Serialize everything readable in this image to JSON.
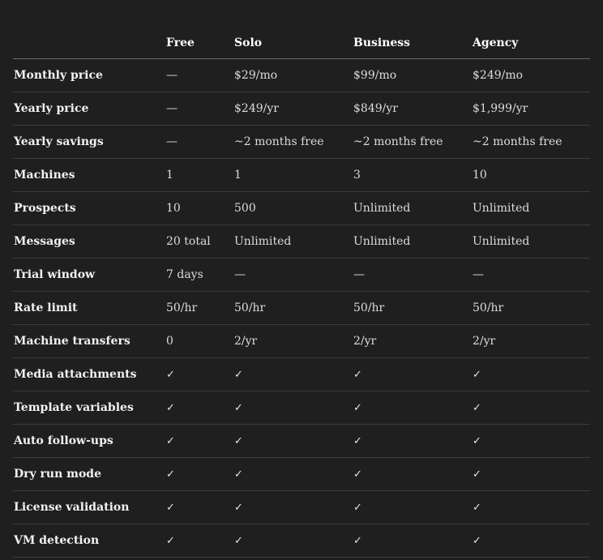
{
  "plans": [
    "Free",
    "Solo",
    "Business",
    "Agency"
  ],
  "rows": [
    {
      "label": "Monthly price",
      "values": [
        "—",
        "$29/mo",
        "$99/mo",
        "$249/mo"
      ]
    },
    {
      "label": "Yearly price",
      "values": [
        "—",
        "$249/yr",
        "$849/yr",
        "$1,999/yr"
      ]
    },
    {
      "label": "Yearly savings",
      "values": [
        "—",
        "~2 months free",
        "~2 months free",
        "~2 months free"
      ]
    },
    {
      "label": "Machines",
      "values": [
        "1",
        "1",
        "3",
        "10"
      ]
    },
    {
      "label": "Prospects",
      "values": [
        "10",
        "500",
        "Unlimited",
        "Unlimited"
      ]
    },
    {
      "label": "Messages",
      "values": [
        "20 total",
        "Unlimited",
        "Unlimited",
        "Unlimited"
      ]
    },
    {
      "label": "Trial window",
      "values": [
        "7 days",
        "—",
        "—",
        "—"
      ]
    },
    {
      "label": "Rate limit",
      "values": [
        "50/hr",
        "50/hr",
        "50/hr",
        "50/hr"
      ]
    },
    {
      "label": "Machine transfers",
      "values": [
        "0",
        "2/yr",
        "2/yr",
        "2/yr"
      ]
    },
    {
      "label": "Media attachments",
      "values": [
        "✓",
        "✓",
        "✓",
        "✓"
      ]
    },
    {
      "label": "Template variables",
      "values": [
        "✓",
        "✓",
        "✓",
        "✓"
      ]
    },
    {
      "label": "Auto follow-ups",
      "values": [
        "✓",
        "✓",
        "✓",
        "✓"
      ]
    },
    {
      "label": "Dry run mode",
      "values": [
        "✓",
        "✓",
        "✓",
        "✓"
      ]
    },
    {
      "label": "License validation",
      "values": [
        "✓",
        "✓",
        "✓",
        "✓"
      ]
    },
    {
      "label": "VM detection",
      "values": [
        "✓",
        "✓",
        "✓",
        "✓"
      ]
    }
  ]
}
